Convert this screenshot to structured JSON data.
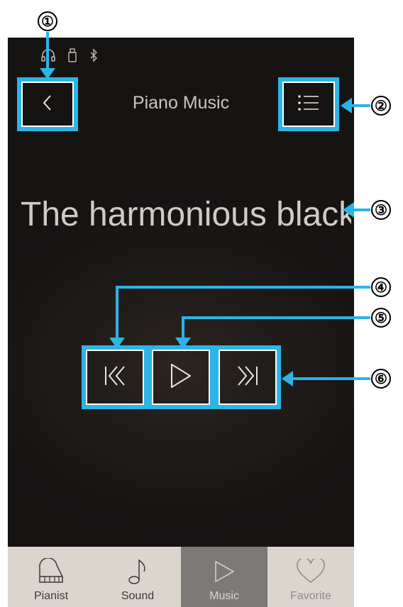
{
  "header": {
    "title": "Piano Music",
    "back_icon": "chevron-left-icon",
    "menu_icon": "list-icon"
  },
  "status_bar": {
    "icons": [
      "headphone-icon",
      "usb-icon",
      "bluetooth-icon"
    ]
  },
  "song": {
    "title": "The harmonious black"
  },
  "controls": {
    "previous_icon": "previous-track-icon",
    "play_icon": "play-icon",
    "next_icon": "next-track-icon"
  },
  "tabs": [
    {
      "label": "Pianist",
      "icon": "piano-icon",
      "active": false
    },
    {
      "label": "Sound",
      "icon": "music-note-icon",
      "active": false
    },
    {
      "label": "Music",
      "icon": "play-icon",
      "active": true
    },
    {
      "label": "Favorite",
      "icon": "heart-icon",
      "active": false
    }
  ],
  "callouts": {
    "c1": "①",
    "c2": "②",
    "c3": "③",
    "c4": "④",
    "c5": "⑤",
    "c6": "⑥"
  },
  "colors": {
    "highlight": "#2cb4e6",
    "tabbar": "#dcd5ce",
    "tab_active": "#7d7977",
    "background": "#1d1a18"
  }
}
